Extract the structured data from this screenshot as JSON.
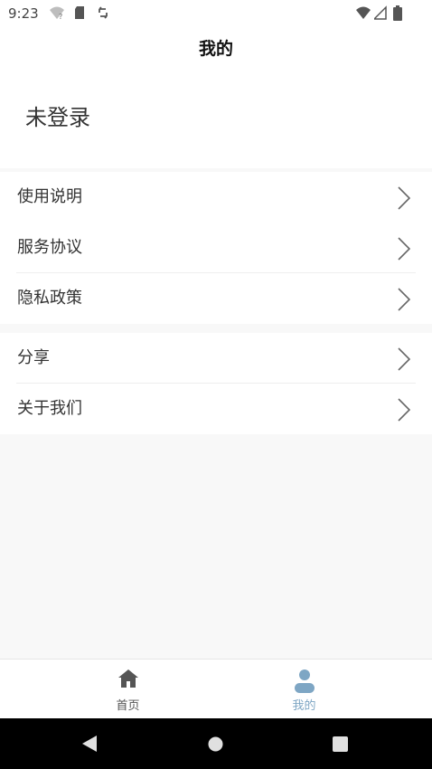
{
  "status_bar": {
    "time": "9:23",
    "left_icons": [
      "wifi-question-icon",
      "sd-card-icon",
      "sync-icon"
    ],
    "right_icons": [
      "wifi-icon",
      "signal-icon",
      "battery-icon"
    ]
  },
  "header": {
    "title": "我的"
  },
  "profile": {
    "login_status": "未登录"
  },
  "menu": {
    "group1": [
      {
        "label": "使用说明",
        "icon": "chevron-right-icon"
      },
      {
        "label": "服务协议",
        "icon": "chevron-right-icon"
      },
      {
        "label": "隐私政策",
        "icon": "chevron-right-icon"
      }
    ],
    "group2": [
      {
        "label": "分享",
        "icon": "chevron-right-icon"
      },
      {
        "label": "关于我们",
        "icon": "chevron-right-icon"
      }
    ]
  },
  "tabbar": {
    "tabs": [
      {
        "label": "首页",
        "icon": "home-icon",
        "active": false
      },
      {
        "label": "我的",
        "icon": "user-icon",
        "active": true
      }
    ]
  },
  "system_nav": {
    "buttons": [
      "back-icon",
      "home-circle-icon",
      "recents-icon"
    ]
  },
  "colors": {
    "page_background": "#f8f8f8",
    "tab_active": "#7ea6c4",
    "tab_inactive": "#555555",
    "nav_bar": "#000000"
  }
}
